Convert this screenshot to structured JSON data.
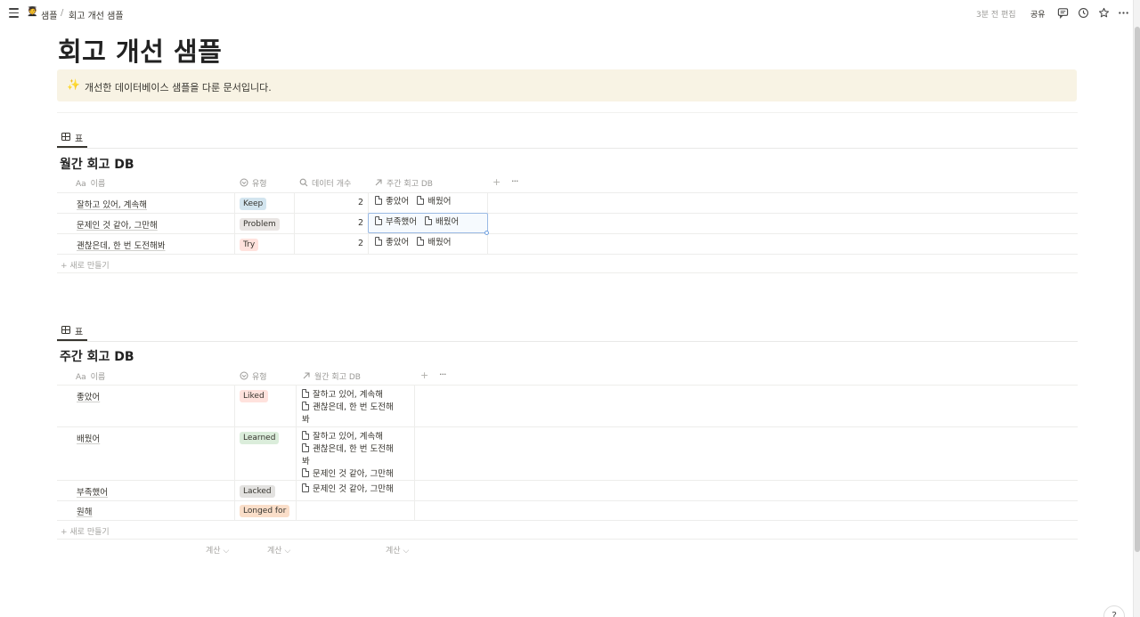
{
  "topbar": {
    "breadcrumb_emoji": "🧑‍🎓",
    "breadcrumb_parent": "샘플",
    "breadcrumb_sep": "/",
    "breadcrumb_current": "회고 개선 샘플",
    "edited": "3분 전 편집",
    "share": "공유"
  },
  "page": {
    "title": "회고 개선 샘플",
    "callout_icon": "✨",
    "callout_text": "개선한 데이터베이스 샘플을 다룬 문서입니다."
  },
  "db1": {
    "view_label": "표",
    "title": "월간 회고 DB",
    "headers": {
      "name": "이름",
      "name_icon": "Aa",
      "type": "유형",
      "count": "데이터 개수",
      "relation": "주간 회고 DB"
    },
    "rows": [
      {
        "name": "잘하고 있어, 계속해",
        "tag": "Keep",
        "count": "2",
        "rel": [
          "좋았어",
          "배웠어"
        ]
      },
      {
        "name": "문제인 것 같아, 그만해",
        "tag": "Problem",
        "count": "2",
        "rel": [
          "부족했어",
          "배웠어"
        ]
      },
      {
        "name": "괜찮은데, 한 번 도전해봐",
        "tag": "Try",
        "count": "2",
        "rel": [
          "좋았어",
          "배웠어"
        ]
      }
    ],
    "new_row": "새로 만들기"
  },
  "db2": {
    "view_label": "표",
    "title": "주간 회고 DB",
    "headers": {
      "name": "이름",
      "name_icon": "Aa",
      "type": "유형",
      "relation": "월간 회고 DB"
    },
    "rows": [
      {
        "name": "좋았어",
        "tag": "Liked",
        "rel_lines": [
          "잘하고 있어, 계속해",
          "괜찮은데, 한 번 도전해",
          "봐"
        ]
      },
      {
        "name": "배웠어",
        "tag": "Learned",
        "rel_lines": [
          "잘하고 있어, 계속해",
          "괜찮은데, 한 번 도전해",
          "봐",
          "문제인 것 같아, 그만해"
        ]
      },
      {
        "name": "부족했어",
        "tag": "Lacked",
        "rel_lines": [
          "문제인 것 같아, 그만해"
        ]
      },
      {
        "name": "원해",
        "tag": "Longed for",
        "rel_lines": []
      }
    ],
    "new_row": "새로 만들기",
    "calc": [
      "계산",
      "계산",
      "계산"
    ]
  },
  "colors": {
    "callout_bg": "#f8f3e4",
    "tag_keep": "#d3e5ef",
    "tag_problem": "#e9e5e3",
    "tag_try": "#ffe2dd",
    "tag_liked": "#ffe2dd",
    "tag_learned": "#dbeddb",
    "tag_lacked": "#e3e2e0",
    "tag_longed": "#fadec9",
    "selection": "#9ab9e4"
  },
  "icons": {
    "menu": "hamburger-icon",
    "comments": "comment-icon",
    "history": "clock-icon",
    "favorite": "star-icon",
    "more": "more-dots-icon",
    "table_view": "table-icon",
    "type_prop": "select-property-icon",
    "count_prop": "search-icon",
    "relation_prop": "arrow-up-right-icon",
    "page": "page-icon",
    "help": "help-icon"
  }
}
